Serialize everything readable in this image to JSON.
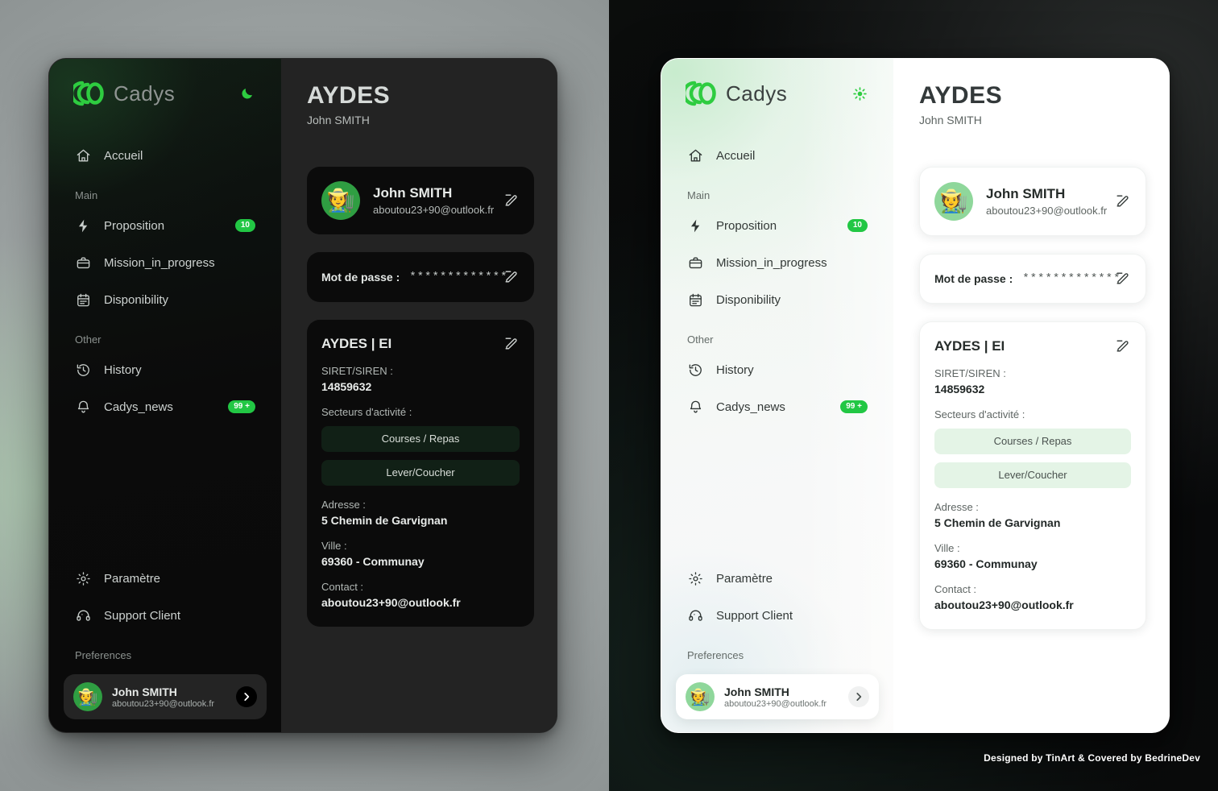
{
  "brand": {
    "name": "Cadys",
    "logo_icon": "cadys-logo-icon",
    "accent": "#22c744"
  },
  "themes": {
    "dark": {
      "toggle_icon": "moon-icon",
      "label": "dark"
    },
    "light": {
      "toggle_icon": "sun-icon",
      "label": "light"
    }
  },
  "sidebar": {
    "top_items": [
      {
        "label": "Accueil",
        "icon": "home-icon"
      }
    ],
    "sections": [
      {
        "title": "Main",
        "items": [
          {
            "label": "Proposition",
            "icon": "bolt-icon",
            "badge": "10"
          },
          {
            "label": "Mission_in_progress",
            "icon": "briefcase-icon",
            "badge": ""
          },
          {
            "label": "Disponibility",
            "icon": "calendar-icon",
            "badge": ""
          }
        ]
      },
      {
        "title": "Other",
        "items": [
          {
            "label": "History",
            "icon": "history-icon",
            "badge": ""
          },
          {
            "label": "Cadys_news",
            "icon": "bell-icon",
            "badge": "99 +"
          }
        ]
      }
    ],
    "bottom_items": [
      {
        "label": "Paramètre",
        "icon": "gear-icon"
      },
      {
        "label": "Support Client",
        "icon": "headset-icon"
      }
    ],
    "preferences_title": "Preferences",
    "user": {
      "name": "John SMITH",
      "email": "aboutou23+90@outlook.fr",
      "avatar_icon": "user-avatar",
      "chevron_icon": "chevron-right-icon"
    }
  },
  "header": {
    "title": "AYDES",
    "subtitle": "John SMITH"
  },
  "profile_card": {
    "name": "John SMITH",
    "email": "aboutou23+90@outlook.fr",
    "avatar_icon": "user-avatar",
    "edit_icon": "edit-pencil-icon"
  },
  "password_card": {
    "label": "Mot de passe :",
    "value": "*************",
    "edit_icon": "edit-pencil-icon"
  },
  "info_card": {
    "title": "AYDES | EI",
    "edit_icon": "edit-pencil-icon",
    "fields": [
      {
        "label": "SIRET/SIREN :",
        "value": "14859632"
      }
    ],
    "sectors_label": "Secteurs d'activité :",
    "sectors": [
      "Courses / Repas",
      "Lever/Coucher"
    ],
    "address_label": "Adresse :",
    "address_value": "5 Chemin de Garvignan",
    "city_label": "Ville :",
    "city_value": "69360 - Communay",
    "contact_label": "Contact :",
    "contact_value": "aboutou23+90@outlook.fr"
  },
  "credit": "Designed by TinArt & Covered by BedrineDev"
}
